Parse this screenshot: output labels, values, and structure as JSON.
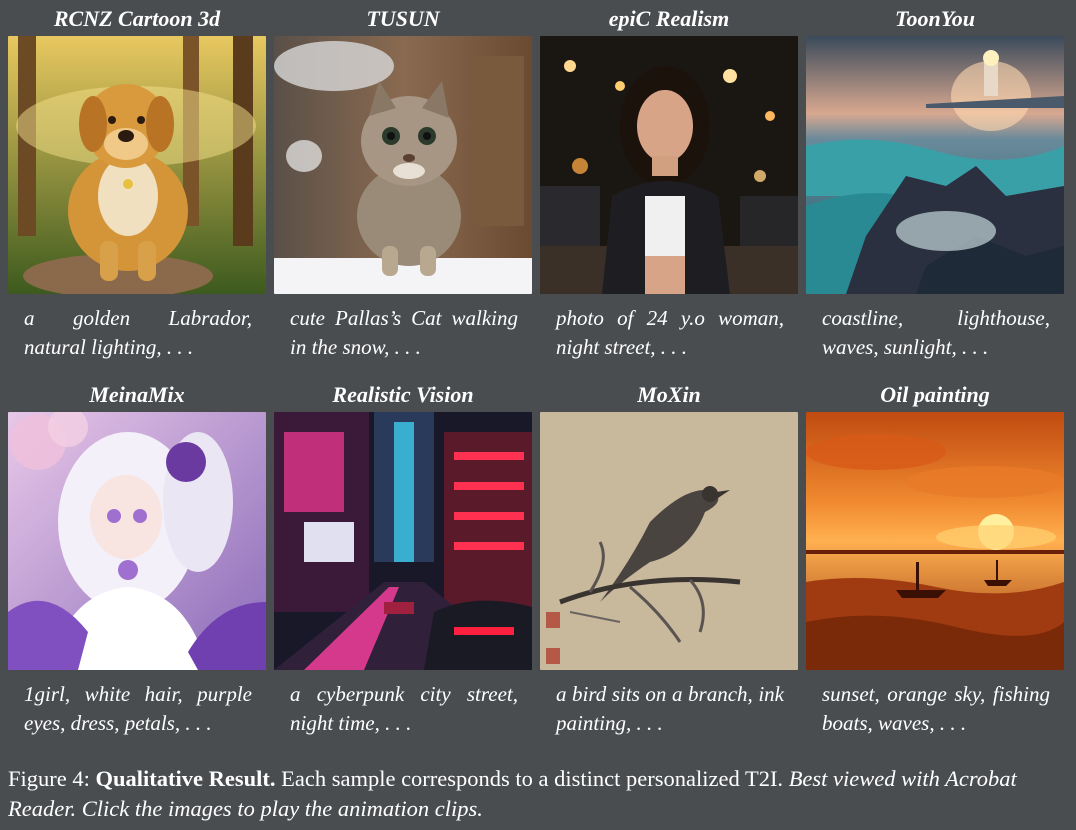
{
  "row1": [
    {
      "title": "RCNZ Cartoon 3d",
      "caption": "a golden Labrador, natural lighting, . . ."
    },
    {
      "title": "TUSUN",
      "caption": "cute Pallas’s Cat walking in the snow, . . ."
    },
    {
      "title": "epiC Realism",
      "caption": "photo of 24 y.o woman, night street, . . ."
    },
    {
      "title": "ToonYou",
      "caption": "coastline, lighthouse, waves, sunlight, . . ."
    }
  ],
  "row2": [
    {
      "title": "MeinaMix",
      "caption": "1girl, white hair, purple eyes, dress, petals, . . ."
    },
    {
      "title": "Realistic Vision",
      "caption": "a cyberpunk city street, night time, . . ."
    },
    {
      "title": "MoXin",
      "caption": "a bird sits on a branch, ink painting, . . ."
    },
    {
      "title": "Oil painting",
      "caption": "sunset, orange sky, fishing boats, waves, . . ."
    }
  ],
  "figure": {
    "label": "Figure 4:",
    "bold": "Qualitative Result.",
    "body": "Each sample corresponds to a distinct personalized T2I.",
    "italic": "Best viewed with Acrobat Reader. Click the images to play the animation clips."
  }
}
